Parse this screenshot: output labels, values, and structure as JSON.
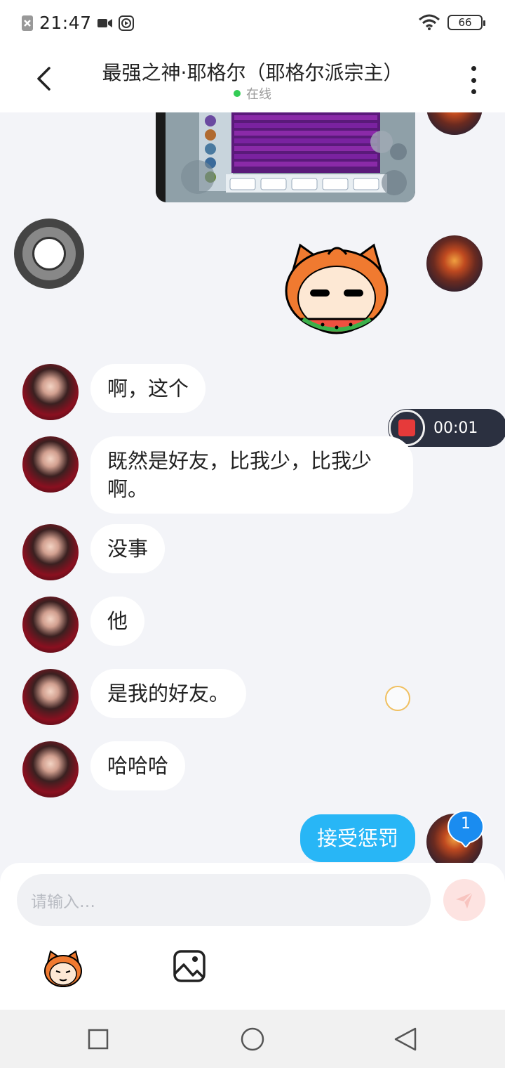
{
  "status_bar": {
    "time": "21:47",
    "battery": "66"
  },
  "header": {
    "title": "最强之神·耶格尔（耶格尔派宗主）",
    "status": "在线"
  },
  "messages": [
    {
      "side": "left",
      "text": "啊，这个"
    },
    {
      "side": "left",
      "text": "既然是好友，比我少，比我少啊。"
    },
    {
      "side": "left",
      "text": "没事"
    },
    {
      "side": "left",
      "text": "他"
    },
    {
      "side": "left",
      "text": "是我的好友。"
    },
    {
      "side": "left",
      "text": "哈哈哈"
    },
    {
      "side": "right",
      "text": "接受惩罚"
    }
  ],
  "recording": {
    "time": "00:01"
  },
  "badge": {
    "count": "1"
  },
  "input": {
    "placeholder": "请输入…"
  },
  "colors": {
    "accent": "#28b6f6",
    "online": "#33cc55",
    "record": "#e63a3a",
    "background": "#f3f4f8"
  },
  "icons": [
    "back-icon",
    "more-icon",
    "send-icon",
    "emoji-icon",
    "image-icon",
    "nav-recents-icon",
    "nav-home-icon",
    "nav-back-icon",
    "video-icon",
    "screen-record-icon",
    "wifi-icon",
    "signal-off-icon"
  ]
}
